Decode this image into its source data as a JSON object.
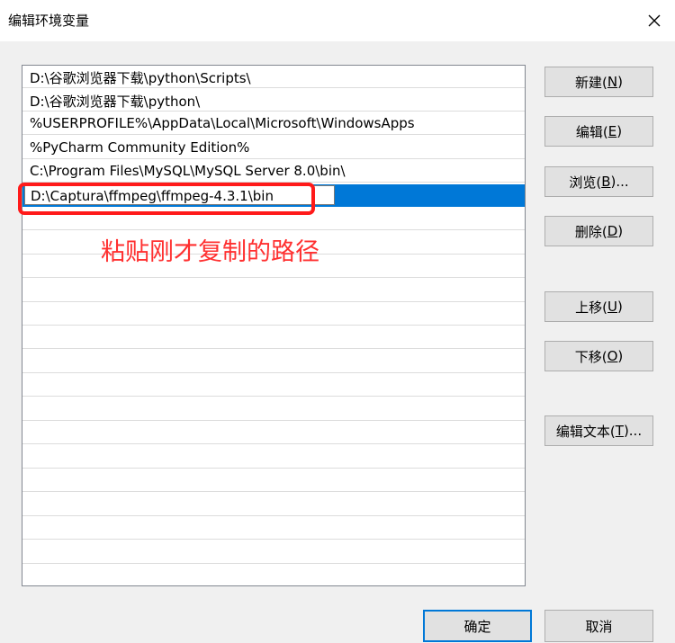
{
  "window": {
    "title": "编辑环境变量",
    "close_icon": "close-icon"
  },
  "paths": [
    "D:\\谷歌浏览器下载\\python\\Scripts\\",
    "D:\\谷歌浏览器下载\\python\\",
    "%USERPROFILE%\\AppData\\Local\\Microsoft\\WindowsApps",
    "%PyCharm Community Edition%",
    "C:\\Program Files\\MySQL\\MySQL Server 8.0\\bin\\",
    "D:\\Captura\\ffmpeg\\ffmpeg-4.3.1\\bin"
  ],
  "selected_index": 5,
  "annotation": {
    "text": "粘贴刚才复制的路径",
    "color": "#ff1a1a"
  },
  "buttons": {
    "new": {
      "label": "新建(",
      "key": "N",
      "tail": ")"
    },
    "edit": {
      "label": "编辑(",
      "key": "E",
      "tail": ")"
    },
    "browse": {
      "label": "浏览(",
      "key": "B",
      "tail": ")..."
    },
    "delete": {
      "label": "删除(",
      "key": "D",
      "tail": ")"
    },
    "move_up": {
      "label": "上移(",
      "key": "U",
      "tail": ")"
    },
    "move_down": {
      "label": "下移(",
      "key": "O",
      "tail": ")"
    },
    "edit_text": {
      "label": "编辑文本(",
      "key": "T",
      "tail": ")..."
    }
  },
  "footer": {
    "ok": "确定",
    "cancel": "取消"
  },
  "colors": {
    "selection": "#0078d7",
    "dialog_bg": "#f0f0f0",
    "annotation": "#ff1a1a"
  }
}
